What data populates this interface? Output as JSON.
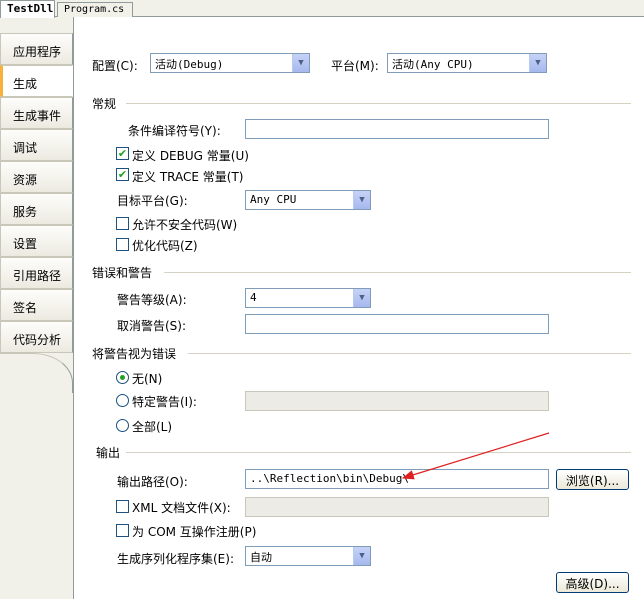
{
  "doc_tabs": [
    "TestDll",
    "Program.cs"
  ],
  "sidebar": {
    "items": [
      "应用程序",
      "生成",
      "生成事件",
      "调试",
      "资源",
      "服务",
      "设置",
      "引用路径",
      "签名",
      "代码分析"
    ],
    "active_index": 1
  },
  "config": {
    "config_label": "配置(C):",
    "config_value": "活动(Debug)",
    "platform_label": "平台(M):",
    "platform_value": "活动(Any CPU)"
  },
  "general": {
    "title": "常规",
    "symbols_label": "条件编译符号(Y):",
    "symbols_value": "",
    "define_debug": "定义 DEBUG 常量(U)",
    "define_debug_checked": true,
    "define_trace": "定义 TRACE 常量(T)",
    "define_trace_checked": true,
    "target_label": "目标平台(G):",
    "target_value": "Any CPU",
    "unsafe_label": "允许不安全代码(W)",
    "optimize_label": "优化代码(Z)"
  },
  "errors": {
    "title": "错误和警告",
    "level_label": "警告等级(A):",
    "level_value": "4",
    "suppress_label": "取消警告(S):",
    "suppress_value": ""
  },
  "treat_warnings": {
    "title": "将警告视为错误",
    "none_label": "无(N)",
    "specific_label": "特定警告(I):",
    "all_label": "全部(L)",
    "selected": "none"
  },
  "output": {
    "title": "输出",
    "path_label": "输出路径(O):",
    "path_value": "..\\Reflection\\bin\\Debug\\",
    "browse_label": "浏览(R)...",
    "xml_label": "XML 文档文件(X):",
    "com_label": "为 COM 互操作注册(P)",
    "serialize_label": "生成序列化程序集(E):",
    "serialize_value": "自动",
    "advanced_label": "高级(D)..."
  },
  "colors": {
    "annotation_arrow": "#e02020",
    "active_tab_accent": "#f8b23c"
  }
}
